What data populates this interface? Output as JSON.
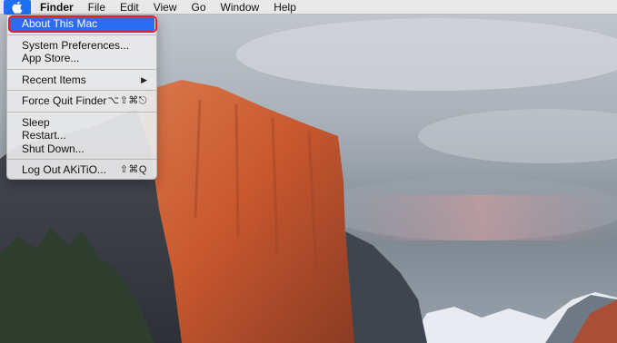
{
  "menubar": {
    "apple_icon": "apple-logo-icon",
    "app_name": "Finder",
    "items": [
      "File",
      "Edit",
      "View",
      "Go",
      "Window",
      "Help"
    ]
  },
  "apple_menu": {
    "about": "About This Mac",
    "system_preferences": "System Preferences...",
    "app_store": "App Store...",
    "recent_items": "Recent Items",
    "recent_items_arrow": "▶",
    "force_quit": "Force Quit Finder",
    "force_quit_shortcut": "⌥⇧⌘⎋",
    "sleep": "Sleep",
    "restart": "Restart...",
    "shut_down": "Shut Down...",
    "log_out": "Log Out AKiTiO...",
    "log_out_shortcut": "⇧⌘Q"
  },
  "colors": {
    "highlight": "#2a6df2",
    "annotation_outline": "#e0202a"
  }
}
